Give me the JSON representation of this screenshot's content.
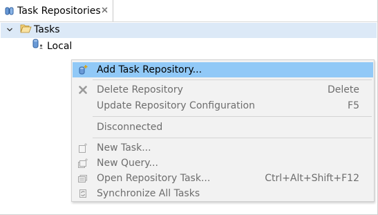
{
  "view": {
    "tab": {
      "label": "Task Repositories",
      "icon": "task-repositories-icon",
      "close_icon": "close-icon"
    }
  },
  "tree": {
    "items": [
      {
        "label": "Tasks",
        "icon": "folder-open-icon",
        "expanded": true,
        "selected": true
      },
      {
        "label": "Local",
        "icon": "local-repository-icon"
      }
    ]
  },
  "context_menu": {
    "items": [
      {
        "label": "Add Task Repository...",
        "accel": "",
        "icon": "add-repository-icon",
        "enabled": true,
        "highlighted": true
      },
      {
        "label": "Delete Repository",
        "accel": "Delete",
        "icon": "delete-x-icon",
        "enabled": false
      },
      {
        "label": "Update Repository Configuration",
        "accel": "F5",
        "icon": "",
        "enabled": false
      },
      {
        "label": "Disconnected",
        "accel": "",
        "icon": "",
        "enabled": false
      },
      {
        "label": "New Task...",
        "accel": "",
        "icon": "new-task-icon",
        "enabled": false
      },
      {
        "label": "New Query...",
        "accel": "",
        "icon": "new-query-icon",
        "enabled": false
      },
      {
        "label": "Open Repository Task...",
        "accel": "Ctrl+Alt+Shift+F12",
        "icon": "open-task-icon",
        "enabled": false
      },
      {
        "label": "Synchronize All Tasks",
        "accel": "",
        "icon": "synchronize-icon",
        "enabled": false
      }
    ]
  },
  "colors": {
    "selection_highlight": "#91c9f7",
    "tree_selection": "#dce9f7",
    "menu_background": "#f2f2f2",
    "disabled_text": "#6d6d6d"
  }
}
